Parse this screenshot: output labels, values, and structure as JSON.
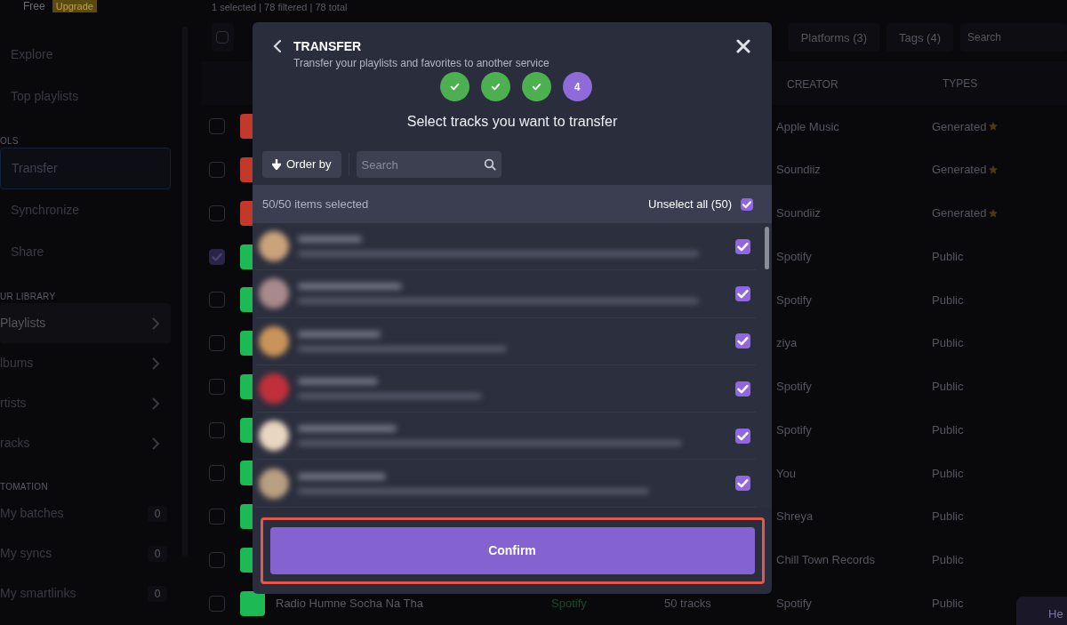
{
  "app": {
    "plan": "Free",
    "upgrade": "Upgrade",
    "status_text": "1 selected | 78 filtered | 78 total",
    "nav": [
      {
        "kind": "item",
        "label": "Explore",
        "selected": false
      },
      {
        "kind": "item",
        "label": "Top playlists",
        "selected": false
      },
      {
        "kind": "section",
        "label": "OLS"
      },
      {
        "kind": "item",
        "label": "Transfer",
        "selected": true
      },
      {
        "kind": "item",
        "label": "Synchronize",
        "selected": false
      },
      {
        "kind": "item",
        "label": "Share",
        "selected": false
      },
      {
        "kind": "section",
        "label": "UR LIBRARY"
      },
      {
        "kind": "expand",
        "label": "Playlists",
        "selected": true
      },
      {
        "kind": "expand",
        "label": "lbums",
        "selected": false
      },
      {
        "kind": "expand",
        "label": "rtists",
        "selected": false
      },
      {
        "kind": "expand",
        "label": "racks",
        "selected": false
      },
      {
        "kind": "section",
        "label": "TOMATION"
      },
      {
        "kind": "count",
        "label": "My batches",
        "count": "0",
        "selected": false
      },
      {
        "kind": "count",
        "label": "My syncs",
        "count": "0",
        "selected": false
      },
      {
        "kind": "count",
        "label": "My smartlinks",
        "count": "0",
        "selected": false
      }
    ],
    "select_all": {
      "checked": false
    },
    "filters": [
      "Platforms (3)",
      "Tags (4)"
    ],
    "search": {
      "placeholder": "Search"
    },
    "columns": [
      "CREATOR",
      "TYPES"
    ],
    "rows": [
      {
        "checked": false,
        "color": "#c0392b",
        "creator": "Apple Music",
        "type": "Generated",
        "starred": true
      },
      {
        "checked": false,
        "color": "#c0392b",
        "creator": "Soundiiz",
        "type": "Generated",
        "starred": true
      },
      {
        "checked": false,
        "color": "#c0392b",
        "creator": "Soundiiz",
        "type": "Generated",
        "starred": true
      },
      {
        "checked": true,
        "color": "#1db954",
        "creator": "Spotify",
        "type": "Public",
        "starred": false
      },
      {
        "checked": false,
        "color": "#1db954",
        "creator": "Spotify",
        "type": "Public",
        "starred": false
      },
      {
        "checked": false,
        "color": "#1db954",
        "creator": "ziya",
        "type": "Public",
        "starred": false
      },
      {
        "checked": false,
        "color": "#1db954",
        "creator": "Spotify",
        "type": "Public",
        "starred": false
      },
      {
        "checked": false,
        "color": "#1db954",
        "creator": "Spotify",
        "type": "Public",
        "starred": false
      },
      {
        "checked": false,
        "color": "#1db954",
        "creator": "You",
        "type": "Public",
        "starred": false
      },
      {
        "checked": false,
        "color": "#1db954",
        "creator": "Shreya",
        "type": "Public",
        "starred": false
      },
      {
        "checked": false,
        "color": "#1db954",
        "creator": "Chill Town Records",
        "type": "Public",
        "starred": false
      },
      {
        "checked": false,
        "color": "#1db954",
        "name": "Radio Humne Socha Na Tha",
        "platform": "Spotify",
        "tracks": "50 tracks",
        "creator": "Spotify",
        "type": "Public",
        "starred": false
      }
    ],
    "help": "He"
  },
  "modal": {
    "title": "TRANSFER",
    "subtitle": "Transfer your playlists and favorites to another service",
    "steps": [
      {
        "done": true
      },
      {
        "done": true
      },
      {
        "done": true
      },
      {
        "done": false,
        "label": "4"
      }
    ],
    "heading": "Select tracks you want to transfer",
    "order_button": "Order by",
    "search": {
      "placeholder": "Search"
    },
    "selection_count": "50/50 items selected",
    "unselect_all": {
      "label": "Unselect all (50)",
      "checked": true
    },
    "tracks": [
      {
        "checked": true,
        "color": "#c9a37a"
      },
      {
        "checked": true,
        "color": "#a88a8a"
      },
      {
        "checked": true,
        "color": "#c8945a"
      },
      {
        "checked": true,
        "color": "#c0303a"
      },
      {
        "checked": true,
        "color": "#e8d6c0"
      },
      {
        "checked": true,
        "color": "#b8a080"
      }
    ],
    "confirm": "Confirm"
  }
}
